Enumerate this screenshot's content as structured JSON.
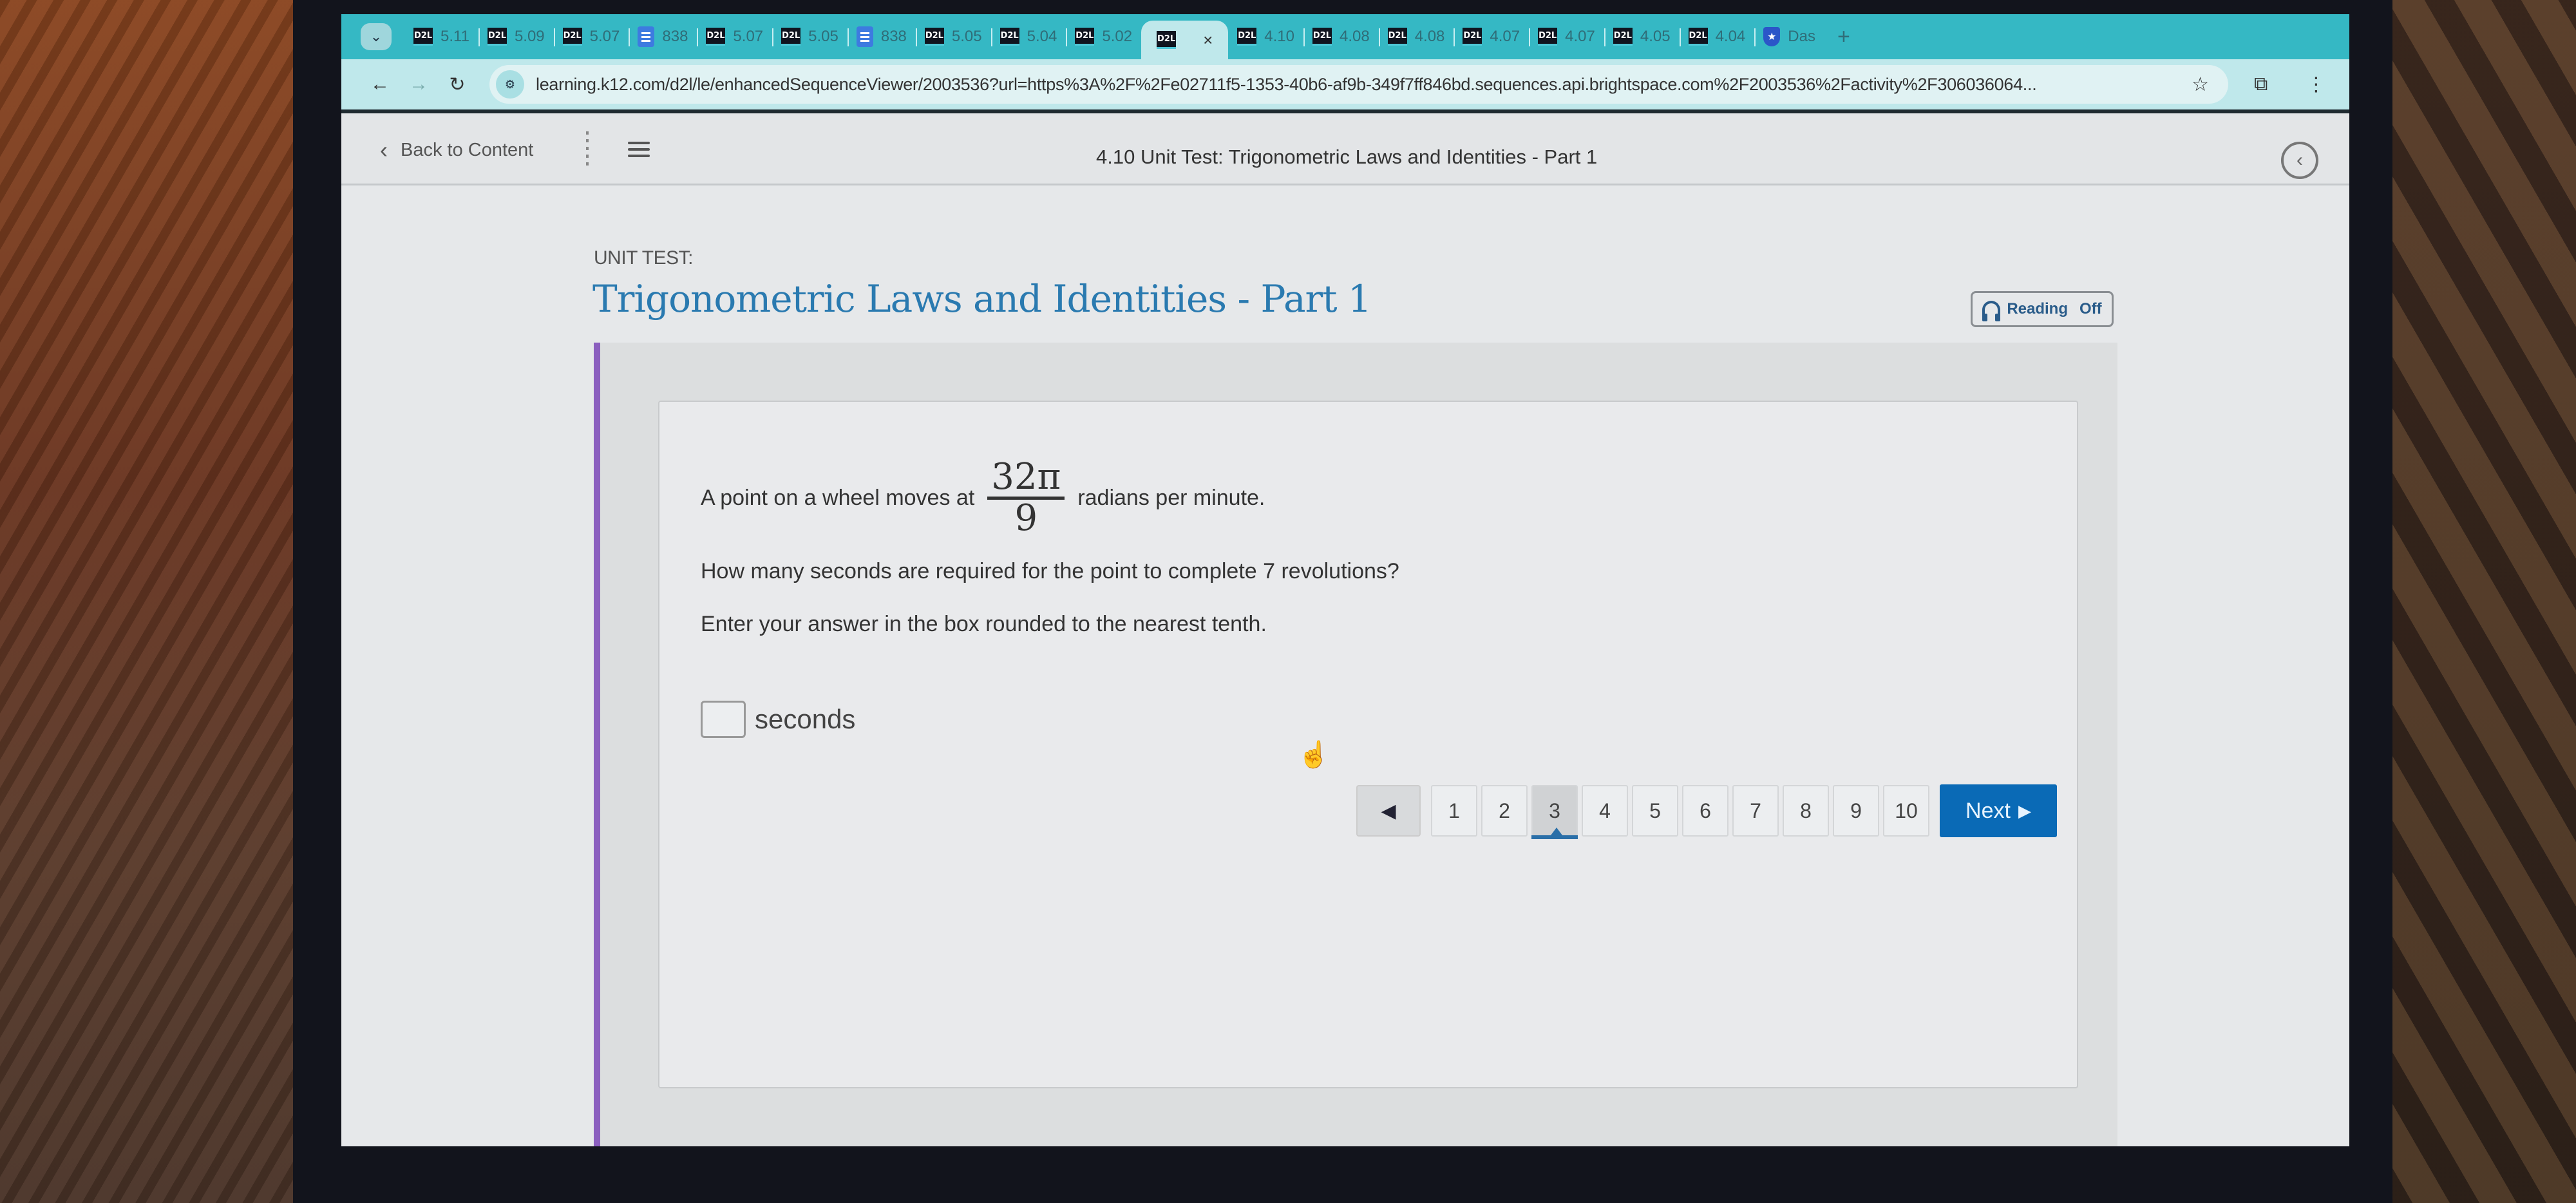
{
  "browser": {
    "tabs": [
      {
        "icon": "d2l",
        "label": "5.11"
      },
      {
        "icon": "d2l",
        "label": "5.09"
      },
      {
        "icon": "d2l",
        "label": "5.07"
      },
      {
        "icon": "doc",
        "label": "838"
      },
      {
        "icon": "d2l",
        "label": "5.07"
      },
      {
        "icon": "d2l",
        "label": "5.05"
      },
      {
        "icon": "doc",
        "label": "838"
      },
      {
        "icon": "d2l",
        "label": "5.05"
      },
      {
        "icon": "d2l",
        "label": "5.04"
      },
      {
        "icon": "d2l",
        "label": "5.02"
      },
      {
        "icon": "d2l",
        "label": "",
        "active": true
      },
      {
        "icon": "d2l",
        "label": "4.10"
      },
      {
        "icon": "d2l",
        "label": "4.08"
      },
      {
        "icon": "d2l",
        "label": "4.08"
      },
      {
        "icon": "d2l",
        "label": "4.07"
      },
      {
        "icon": "d2l",
        "label": "4.07"
      },
      {
        "icon": "d2l",
        "label": "4.05"
      },
      {
        "icon": "d2l",
        "label": "4.04"
      },
      {
        "icon": "shield",
        "label": "Das"
      }
    ],
    "close_glyph": "×",
    "new_tab_glyph": "+",
    "url": "learning.k12.com/d2l/le/enhancedSequenceViewer/2003536?url=https%3A%2F%2Fe02711f5-1353-40b6-af9b-349f7ff846bd.sequences.api.brightspace.com%2F2003536%2Factivity%2F306036064..."
  },
  "d2l_nav": {
    "back_label": "Back to Content",
    "title": "4.10 Unit Test: Trigonometric Laws and Identities - Part 1"
  },
  "page": {
    "unit_label": "UNIT TEST:",
    "title": "Trigonometric Laws and Identities - Part 1",
    "reading": {
      "label": "Reading",
      "state": "Off"
    }
  },
  "question": {
    "line1_before": "A point on a wheel moves at",
    "fraction_numerator": "32π",
    "fraction_denominator": "9",
    "line1_after": "radians per minute.",
    "line2": "How many seconds are required for the point to complete 7 revolutions?",
    "line3": "Enter your answer in the box rounded to the nearest tenth.",
    "answer_value": "",
    "answer_unit": "seconds"
  },
  "pagination": {
    "pages": [
      "1",
      "2",
      "3",
      "4",
      "5",
      "6",
      "7",
      "8",
      "9",
      "10"
    ],
    "current": "3",
    "next_label": "Next"
  }
}
